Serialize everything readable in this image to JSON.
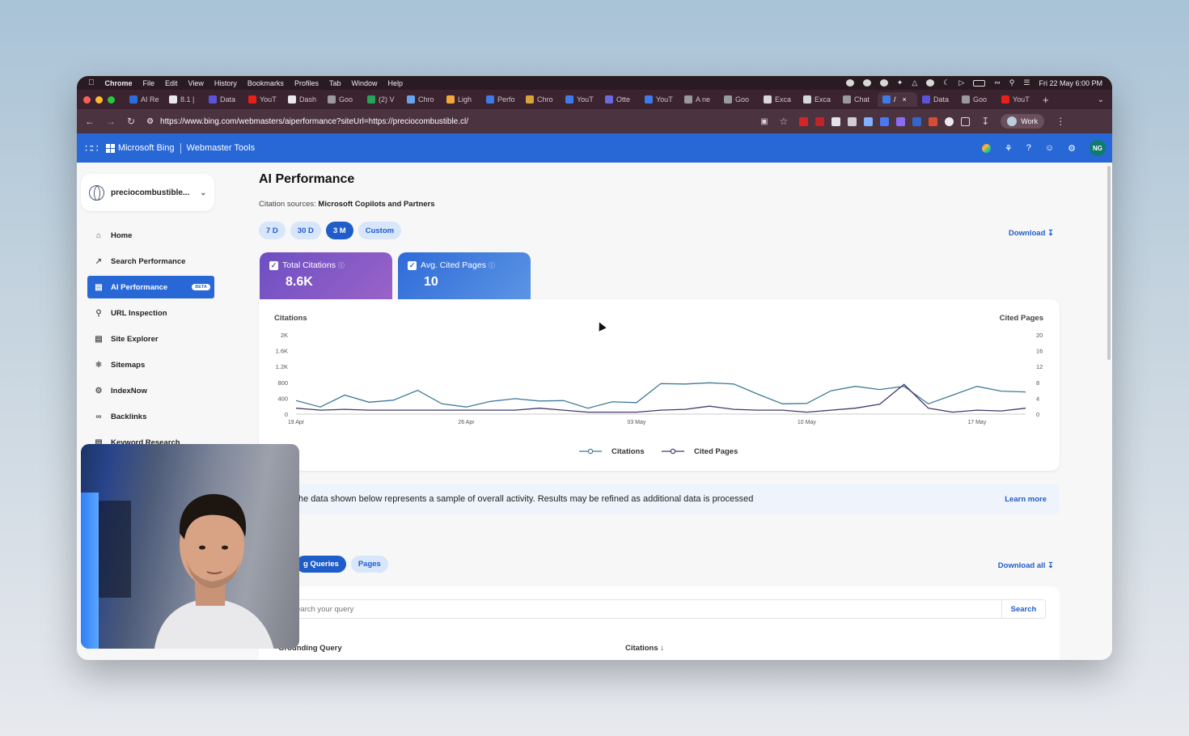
{
  "menubar": {
    "app": "Chrome",
    "items": [
      "File",
      "Edit",
      "View",
      "History",
      "Bookmarks",
      "Profiles",
      "Tab",
      "Window",
      "Help"
    ],
    "datetime": "Fri 22 May  6:00 PM"
  },
  "tabs": [
    {
      "label": "AI Re",
      "color": "#2a6edc",
      "active": false
    },
    {
      "label": "8.1 |",
      "color": "#e8e8e8",
      "active": false
    },
    {
      "label": "Data",
      "color": "#5b54d6",
      "active": false
    },
    {
      "label": "YouT",
      "color": "#e62117",
      "active": false
    },
    {
      "label": "Dash",
      "color": "#e8e8e8",
      "active": false
    },
    {
      "label": "Goo",
      "color": "#9a9a9a",
      "active": false
    },
    {
      "label": "(2) V",
      "color": "#25a35a",
      "active": false
    },
    {
      "label": "Chro",
      "color": "#69a3f0",
      "active": false
    },
    {
      "label": "Ligh",
      "color": "#f2a93b",
      "active": false
    },
    {
      "label": "Perfo",
      "color": "#3e7be8",
      "active": false
    },
    {
      "label": "Chro",
      "color": "#d9a23a",
      "active": false
    },
    {
      "label": "YouT",
      "color": "#3e7be8",
      "active": false
    },
    {
      "label": "Otte",
      "color": "#6a6ae0",
      "active": false
    },
    {
      "label": "YouT",
      "color": "#3e7be8",
      "active": false
    },
    {
      "label": "A ne",
      "color": "#999",
      "active": false
    },
    {
      "label": "Goo",
      "color": "#9a9a9a",
      "active": false
    },
    {
      "label": "Exca",
      "color": "#d8d8d8",
      "active": false
    },
    {
      "label": "Exca",
      "color": "#d8d8d8",
      "active": false
    },
    {
      "label": "Chat",
      "color": "#9a9a9a",
      "active": false
    },
    {
      "label": "/",
      "color": "#3e7be8",
      "active": true
    },
    {
      "label": "Data",
      "color": "#5b54d6",
      "active": false
    },
    {
      "label": "Goo",
      "color": "#9a9a9a",
      "active": false
    },
    {
      "label": "YouT",
      "color": "#e62117",
      "active": false
    }
  ],
  "address": {
    "url": "https://www.bing.com/webmasters/aiperformance?siteUrl=https://preciocombustible.cl/",
    "profile": "Work"
  },
  "bing": {
    "brand": "Microsoft Bing",
    "product": "Webmaster Tools",
    "user_initials": "NG"
  },
  "sidebar": {
    "site": "preciocombustible...",
    "items": [
      {
        "label": "Home",
        "icon": "home-icon"
      },
      {
        "label": "Search Performance",
        "icon": "trend-icon"
      },
      {
        "label": "AI Performance",
        "icon": "ai-icon",
        "badge": "BETA",
        "active": true
      },
      {
        "label": "URL Inspection",
        "icon": "magnifier-icon"
      },
      {
        "label": "Site Explorer",
        "icon": "document-icon"
      },
      {
        "label": "Sitemaps",
        "icon": "sitemap-icon"
      },
      {
        "label": "IndexNow",
        "icon": "gear-icon"
      },
      {
        "label": "Backlinks",
        "icon": "link-icon"
      },
      {
        "label": "Keyword Research",
        "icon": "keyword-icon"
      }
    ]
  },
  "main": {
    "title": "AI Performance",
    "citation_label": "Citation sources:",
    "citation_value": "Microsoft Copilots and Partners",
    "ranges": [
      "7 D",
      "30 D",
      "3 M",
      "Custom"
    ],
    "selected_range": "3 M",
    "download": "Download",
    "metric1": {
      "label": "Total Citations",
      "value": "8.6K"
    },
    "metric2": {
      "label": "Avg. Cited Pages",
      "value": "10"
    },
    "notice": "he data shown below represents a sample of overall activity. Results may be refined as additional data is processed",
    "learn_more": "Learn more",
    "tab_queries": "g Queries",
    "tab_pages": "Pages",
    "download_all": "Download all",
    "search_placeholder": "earch your query",
    "search_button": "Search",
    "col_query": "Grounding Query",
    "col_citations": "Citations"
  },
  "chart_data": {
    "type": "line",
    "left_axis_label": "Citations",
    "right_axis_label": "Cited Pages",
    "y_left_ticks": [
      "0",
      "400",
      "800",
      "1.2K",
      "1.6K",
      "2K"
    ],
    "y_right_ticks": [
      "0",
      "4",
      "8",
      "12",
      "16",
      "20"
    ],
    "ylim_left": [
      0,
      2000
    ],
    "ylim_right": [
      0,
      20
    ],
    "x_tick_labels": [
      "19 Apr",
      "26 Apr",
      "03 May",
      "10 May",
      "17 May"
    ],
    "x_tick_index": [
      0,
      7,
      14,
      21,
      28
    ],
    "series": [
      {
        "name": "Citations",
        "axis": "left",
        "color": "#3e7a96",
        "values": [
          340,
          180,
          480,
          300,
          350,
          600,
          260,
          180,
          320,
          390,
          330,
          340,
          150,
          310,
          290,
          770,
          760,
          790,
          760,
          500,
          260,
          270,
          590,
          700,
          620,
          700,
          260,
          480,
          700,
          580,
          560
        ]
      },
      {
        "name": "Cited Pages",
        "axis": "right",
        "color": "#413a6b",
        "values": [
          1.5,
          1.0,
          1.2,
          1.0,
          1.0,
          1.0,
          1.0,
          1.0,
          1.0,
          1.0,
          1.5,
          1.0,
          0.5,
          0.5,
          0.5,
          1.0,
          1.2,
          2.0,
          1.2,
          1.0,
          1.0,
          0.5,
          1.0,
          1.5,
          2.5,
          7.5,
          1.5,
          0.5,
          1.0,
          0.8,
          1.5
        ]
      }
    ]
  }
}
